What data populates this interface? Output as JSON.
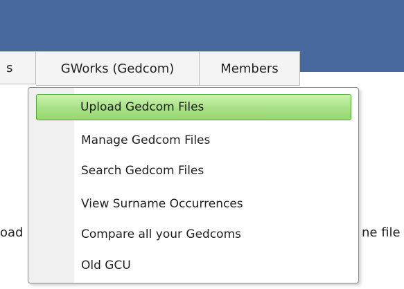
{
  "colors": {
    "header": "#47689d",
    "highlight": "#a8e085",
    "highlight_border": "#4fa836"
  },
  "tabs": [
    {
      "label": "s"
    },
    {
      "label": "GWorks (Gedcom)"
    },
    {
      "label": "Members"
    }
  ],
  "background_text": {
    "left_fragment": "oad",
    "right_fragment": "ne file"
  },
  "dropdown": {
    "items": [
      {
        "label": "Upload Gedcom Files",
        "highlighted": true
      },
      {
        "label": "Manage Gedcom Files"
      },
      {
        "label": "Search Gedcom Files"
      },
      {
        "label": "View Surname Occurrences"
      },
      {
        "label": "Compare all your Gedcoms"
      },
      {
        "label": "Old GCU"
      }
    ]
  }
}
